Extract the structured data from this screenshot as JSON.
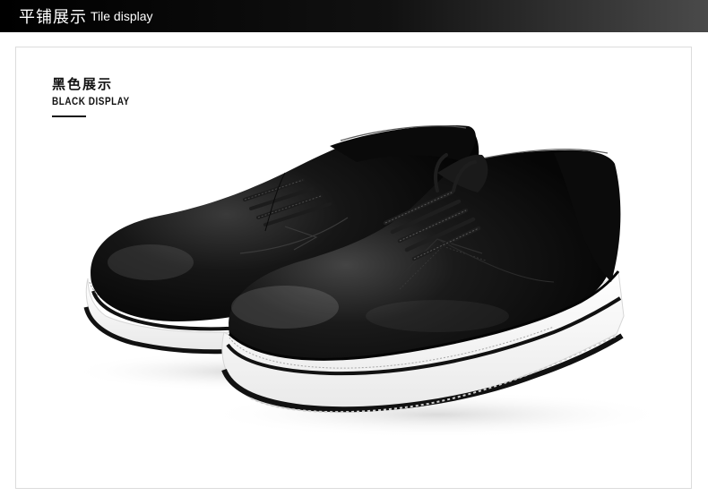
{
  "header": {
    "title_zh": "平铺展示",
    "title_en": "Tile display"
  },
  "section": {
    "label_zh": "黑色展示",
    "label_en": "BLACK DISPLAY"
  },
  "product": {
    "image_subject": "black-lace-up-platform-oxford-shoes",
    "upper_color": "#0d0d0d",
    "sole_color": "#ffffff",
    "stripe_color": "#111111"
  }
}
